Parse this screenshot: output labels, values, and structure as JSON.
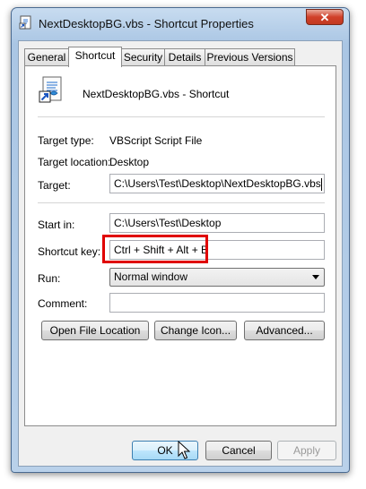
{
  "window": {
    "title": "NextDesktopBG.vbs - Shortcut Properties",
    "close_label": "✕"
  },
  "tabs": [
    {
      "label": "General",
      "active": false
    },
    {
      "label": "Shortcut",
      "active": true
    },
    {
      "label": "Security",
      "active": false
    },
    {
      "label": "Details",
      "active": false
    },
    {
      "label": "Previous Versions",
      "active": false
    }
  ],
  "shortcut": {
    "name": "NextDesktopBG.vbs - Shortcut",
    "target_type_label": "Target type:",
    "target_type_value": "VBScript Script File",
    "target_location_label": "Target location:",
    "target_location_value": "Desktop",
    "target_label": "Target:",
    "target_value": "C:\\Users\\Test\\Desktop\\NextDesktopBG.vbs",
    "start_in_label": "Start in:",
    "start_in_value": "C:\\Users\\Test\\Desktop",
    "shortcut_key_label": "Shortcut key:",
    "shortcut_key_value": "Ctrl + Shift + Alt + B",
    "run_label": "Run:",
    "run_value": "Normal window",
    "comment_label": "Comment:",
    "comment_value": ""
  },
  "buttons": {
    "open_file_location": "Open File Location",
    "change_icon": "Change Icon...",
    "advanced": "Advanced...",
    "ok": "OK",
    "cancel": "Cancel",
    "apply": "Apply"
  },
  "colors": {
    "highlight": "#e00000",
    "title_bar": "#aac6e4"
  },
  "icons": {
    "title": "script-shortcut-icon",
    "file": "vbs-script-shortcut-icon"
  }
}
